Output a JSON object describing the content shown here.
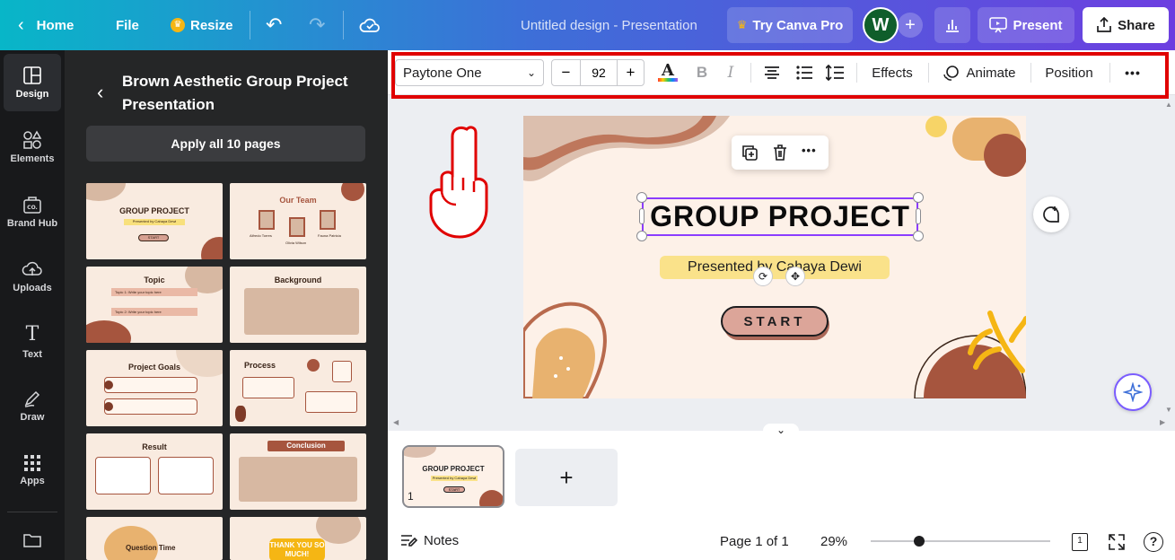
{
  "topbar": {
    "home": "Home",
    "file": "File",
    "resize": "Resize",
    "doc_title": "Untitled design - Presentation",
    "try_pro": "Try Canva Pro",
    "avatar_initial": "W",
    "present": "Present",
    "share": "Share"
  },
  "rail": {
    "items": [
      {
        "label": "Design"
      },
      {
        "label": "Elements"
      },
      {
        "label": "Brand Hub"
      },
      {
        "label": "Uploads"
      },
      {
        "label": "Text"
      },
      {
        "label": "Draw"
      },
      {
        "label": "Apps"
      }
    ]
  },
  "panel": {
    "template_title_line1": "Brown Aesthetic Group Project",
    "template_title_line2": "Presentation",
    "apply_button": "Apply all 10 pages"
  },
  "thumbs": {
    "t1_title": "GROUP PROJECT",
    "t1_sub": "Presented by Cahaya Dewi",
    "t1_btn": "START",
    "t2_title": "Our Team",
    "t2_n1": "Alfredo Torres",
    "t2_n2": "Olivia Wilson",
    "t2_n3": "Fauna Patricia",
    "t3_title": "Topic",
    "t3_i1": "Topic 1: Write your topic here",
    "t3_i2": "Topic 2: Write your topic here",
    "t4_title": "Background",
    "t5_title": "Project Goals",
    "t6_title": "Process",
    "t7_title": "Result",
    "t8_title": "Conclusion",
    "t9_title": "Question Time",
    "t10_title": "THANK YOU SO MUCH!"
  },
  "toolbar": {
    "font": "Paytone One",
    "minus": "−",
    "font_size": "92",
    "plus": "+",
    "bold": "B",
    "italic": "I",
    "effects": "Effects",
    "animate": "Animate",
    "position": "Position",
    "more": "•••"
  },
  "slide": {
    "title": "GROUP PROJECT",
    "subtitle": "Presented by Cahaya Dewi",
    "button": "START"
  },
  "bottom": {
    "page_label": "Page 1 of 1",
    "zoom": "29%",
    "notes": "Notes",
    "page_num": "1",
    "mini_title": "GROUP PROJECT",
    "mini_sub": "Presented by Cahaya Dewi",
    "mini_btn": "START",
    "add": "+",
    "page_count_icon": "1"
  },
  "colors": {
    "brand_gradient_start": "#08b6c8",
    "brand_gradient_end": "#6d3fe0",
    "highlight_red": "#e00000",
    "slide_bg": "#fdf1e8",
    "accent_brown": "#a6553e"
  }
}
